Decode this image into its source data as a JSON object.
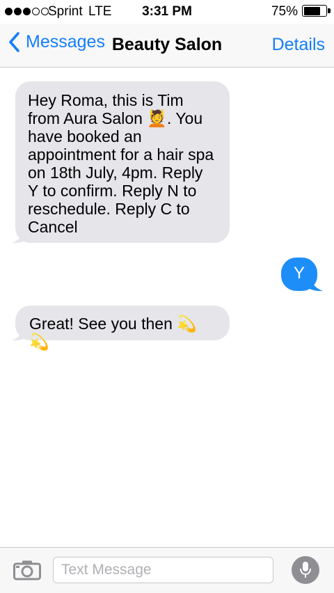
{
  "status_bar": {
    "carrier": "Sprint",
    "network": "LTE",
    "time": "3:31 PM",
    "battery_percent_text": "75%",
    "battery_level": 0.75,
    "signal_bars_filled": 3,
    "signal_bars_total": 5
  },
  "nav": {
    "back_label": "Messages",
    "title": "Beauty Salon",
    "details_label": "Details"
  },
  "messages": [
    {
      "direction": "incoming",
      "text": "Hey Roma, this is Tim from Aura Salon 💆. You have booked an appointment for a hair spa on 18th July, 4pm. Reply Y to confirm. Reply N to reschedule. Reply C to Cancel"
    },
    {
      "direction": "outgoing",
      "text": "Y"
    },
    {
      "direction": "incoming",
      "text": "Great! See you then 💫💫"
    }
  ],
  "input": {
    "placeholder": "Text Message"
  },
  "colors": {
    "accent": "#147efb",
    "incoming_bubble": "#e5e5ea",
    "outgoing_bubble": "#1d8ef8"
  },
  "icons": [
    "chevron-left-icon",
    "camera-icon",
    "microphone-icon"
  ]
}
